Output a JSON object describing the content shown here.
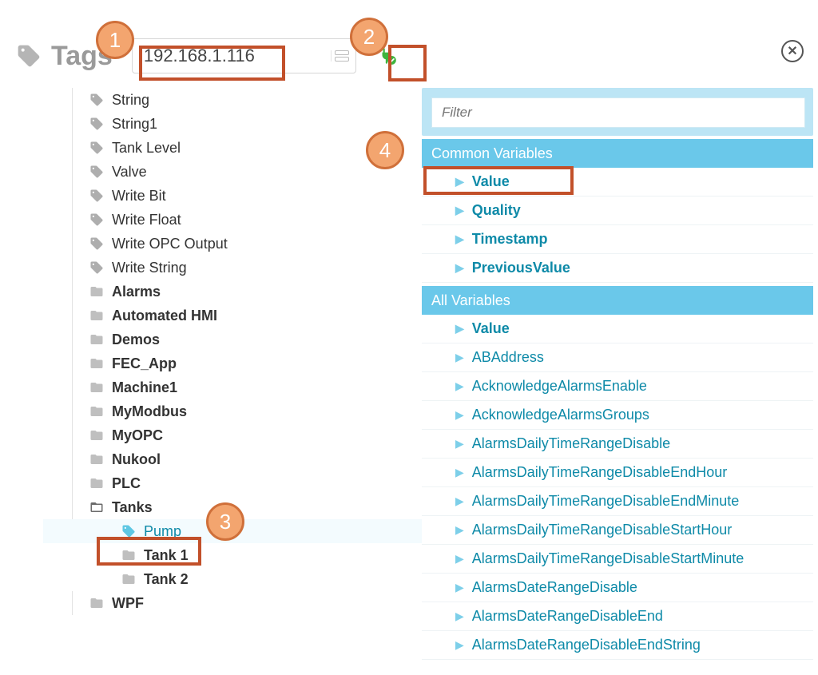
{
  "header": {
    "title": "Tags",
    "ip_value": "192.168.1.116"
  },
  "filter": {
    "placeholder": "Filter"
  },
  "callouts": {
    "c1": "1",
    "c2": "2",
    "c3": "3",
    "c4": "4"
  },
  "tree": {
    "items": [
      {
        "label": "String",
        "type": "tag"
      },
      {
        "label": "String1",
        "type": "tag"
      },
      {
        "label": "Tank Level",
        "type": "tag"
      },
      {
        "label": "Valve",
        "type": "tag"
      },
      {
        "label": "Write Bit",
        "type": "tag"
      },
      {
        "label": "Write Float",
        "type": "tag"
      },
      {
        "label": "Write OPC Output",
        "type": "tag"
      },
      {
        "label": "Write String",
        "type": "tag"
      },
      {
        "label": "Alarms",
        "type": "folder"
      },
      {
        "label": "Automated HMI",
        "type": "folder"
      },
      {
        "label": "Demos",
        "type": "folder"
      },
      {
        "label": "FEC_App",
        "type": "folder"
      },
      {
        "label": "Machine1",
        "type": "folder"
      },
      {
        "label": "MyModbus",
        "type": "folder"
      },
      {
        "label": "MyOPC",
        "type": "folder"
      },
      {
        "label": "Nukool",
        "type": "folder"
      },
      {
        "label": "PLC",
        "type": "folder"
      }
    ],
    "tanks": {
      "label": "Tanks",
      "children": [
        {
          "label": "Pump",
          "type": "tag",
          "selected": true
        },
        {
          "label": "Tank 1",
          "type": "folder"
        },
        {
          "label": "Tank 2",
          "type": "folder"
        }
      ]
    },
    "wpf": {
      "label": "WPF"
    }
  },
  "right": {
    "section_common": "Common Variables",
    "common": [
      {
        "label": "Value",
        "bold": true
      },
      {
        "label": "Quality",
        "bold": true
      },
      {
        "label": "Timestamp",
        "bold": true
      },
      {
        "label": "PreviousValue",
        "bold": true
      }
    ],
    "section_all": "All Variables",
    "all": [
      {
        "label": "Value",
        "bold": true
      },
      {
        "label": "ABAddress"
      },
      {
        "label": "AcknowledgeAlarmsEnable"
      },
      {
        "label": "AcknowledgeAlarmsGroups"
      },
      {
        "label": "AlarmsDailyTimeRangeDisable"
      },
      {
        "label": "AlarmsDailyTimeRangeDisableEndHour"
      },
      {
        "label": "AlarmsDailyTimeRangeDisableEndMinute"
      },
      {
        "label": "AlarmsDailyTimeRangeDisableStartHour"
      },
      {
        "label": "AlarmsDailyTimeRangeDisableStartMinute"
      },
      {
        "label": "AlarmsDateRangeDisable"
      },
      {
        "label": "AlarmsDateRangeDisableEnd"
      },
      {
        "label": "AlarmsDateRangeDisableEndString"
      }
    ]
  }
}
